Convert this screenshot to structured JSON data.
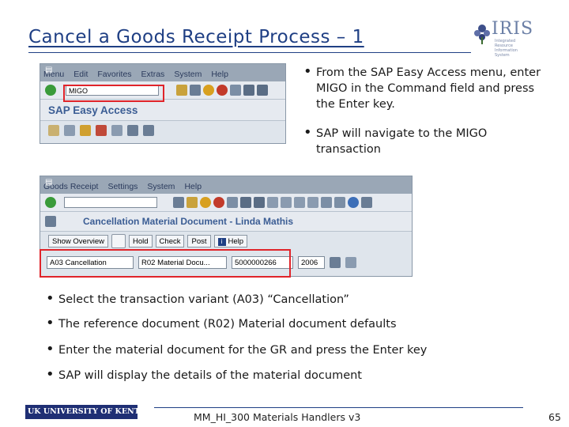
{
  "slide": {
    "title": "Cancel a Goods Receipt Process – 1",
    "page_number": "65",
    "footer": "MM_HI_300 Materials Handlers v3"
  },
  "logo": {
    "text": "IRIS",
    "subtext": "Integrated Resource Information System"
  },
  "university_logo": {
    "text": "UK UNIVERSITY OF KENTUCKY"
  },
  "bullets_right": [
    "From the SAP Easy Access menu, enter MIGO in the Command field and press the Enter key.",
    "SAP will navigate to the MIGO transaction"
  ],
  "bullets_bottom": [
    "Select the transaction variant (A03) “Cancellation”",
    "The reference document (R02) Material document defaults",
    "Enter the material document for the GR and press the Enter key",
    "SAP will display the details of the material document"
  ],
  "sap1": {
    "menu": [
      "Menu",
      "Edit",
      "Favorites",
      "Extras",
      "System",
      "Help"
    ],
    "command_value": "MIGO",
    "app_title": "SAP Easy Access"
  },
  "sap2": {
    "menu": [
      "Goods Receipt",
      "Settings",
      "System",
      "Help"
    ],
    "app_title": "Cancellation Material Document - Linda Mathis",
    "buttons": {
      "show_overview": "Show Overview",
      "hold": "Hold",
      "check": "Check",
      "post": "Post",
      "help": "Help"
    },
    "fields": {
      "transaction": "A03 Cancellation",
      "reference": "R02 Material Docu...",
      "doc_number": "5000000266",
      "year": "2006"
    }
  },
  "colors": {
    "title_blue": "#1f3f84",
    "highlight_red": "#e0242a",
    "sap_title_blue": "#3b5d94"
  }
}
